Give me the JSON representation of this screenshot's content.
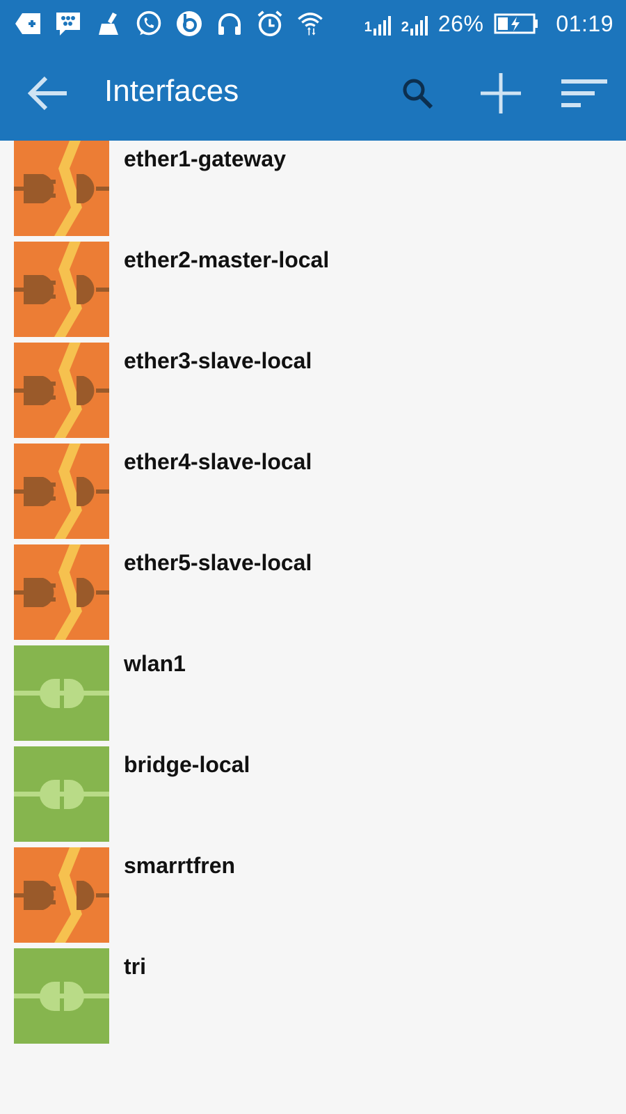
{
  "status_bar": {
    "battery": "26%",
    "time": "01:19",
    "signal_1": "1",
    "signal_2": "2",
    "icons": [
      "notification-plus-icon",
      "bbm-icon",
      "cleaner-icon",
      "whatsapp-icon",
      "beats-icon",
      "headphones-icon",
      "alarm-icon",
      "wifi-icon",
      "signal-icon",
      "signal-icon",
      "battery-charging-icon"
    ]
  },
  "app_bar": {
    "title": "Interfaces",
    "icons": [
      "back-arrow-icon",
      "search-icon",
      "add-icon",
      "sort-icon"
    ]
  },
  "colors": {
    "primary": "#1c75bc",
    "ethernet_bg": "#ec7d35",
    "ethernet_plug": "#9a5a2a",
    "ethernet_bolt": "#f6c14f",
    "wireless_bg": "#86b54e",
    "wireless_plug": "#b9db87"
  },
  "interfaces": [
    {
      "name": "ether1-gateway",
      "type": "ethernet"
    },
    {
      "name": "ether2-master-local",
      "type": "ethernet"
    },
    {
      "name": "ether3-slave-local",
      "type": "ethernet"
    },
    {
      "name": "ether4-slave-local",
      "type": "ethernet"
    },
    {
      "name": "ether5-slave-local",
      "type": "ethernet"
    },
    {
      "name": "wlan1",
      "type": "active"
    },
    {
      "name": "bridge-local",
      "type": "active"
    },
    {
      "name": "smarrtfren",
      "type": "ethernet"
    },
    {
      "name": "tri",
      "type": "active"
    }
  ]
}
